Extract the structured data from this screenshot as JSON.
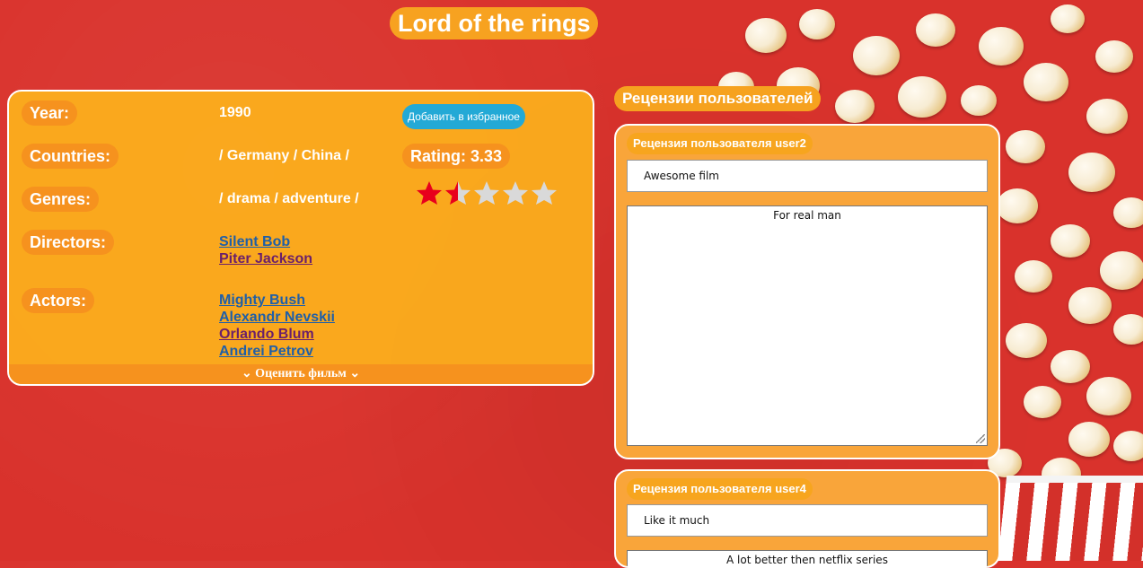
{
  "movie": {
    "title": "Lord of the rings",
    "labels": {
      "year": "Year:",
      "countries": "Countries:",
      "genres": "Genres:",
      "directors": "Directors:",
      "actors": "Actors:"
    },
    "year": "1990",
    "countries": "/ Germany / China /",
    "genres": "/ drama / adventure /",
    "directors": [
      {
        "name": "Silent Bob",
        "visited": false
      },
      {
        "name": "Piter Jackson",
        "visited": true
      }
    ],
    "actors": [
      {
        "name": "Mighty Bush",
        "visited": false
      },
      {
        "name": "Alexandr Nevskii",
        "visited": false
      },
      {
        "name": "Orlando Blum",
        "visited": true
      },
      {
        "name": "Andrei Petrov",
        "visited": false
      }
    ],
    "favorite_button": "Добавить в избранное",
    "rating_label": "Rating: 3.33",
    "stars": {
      "filled": 1.5,
      "total": 5,
      "color_filled": "#e8001c",
      "color_empty": "#d9d9d9"
    },
    "rate_toggle": "⌄ Оценить фильм ⌄"
  },
  "reviews": {
    "section_title": "Рецензии пользователей",
    "items": [
      {
        "header": "Рецензия пользователя user2",
        "headline": "Awesome film",
        "body": "For real man"
      },
      {
        "header": "Рецензия пользователя user4",
        "headline": "Like it much",
        "body": "A lot better then netflix series"
      }
    ]
  },
  "colors": {
    "background": "#d9322c",
    "panel": "#fcb01c",
    "pill": "#f6921e",
    "button": "#23a9d6",
    "link": "#1f5fa8",
    "link_visited": "#6a1f6b"
  }
}
